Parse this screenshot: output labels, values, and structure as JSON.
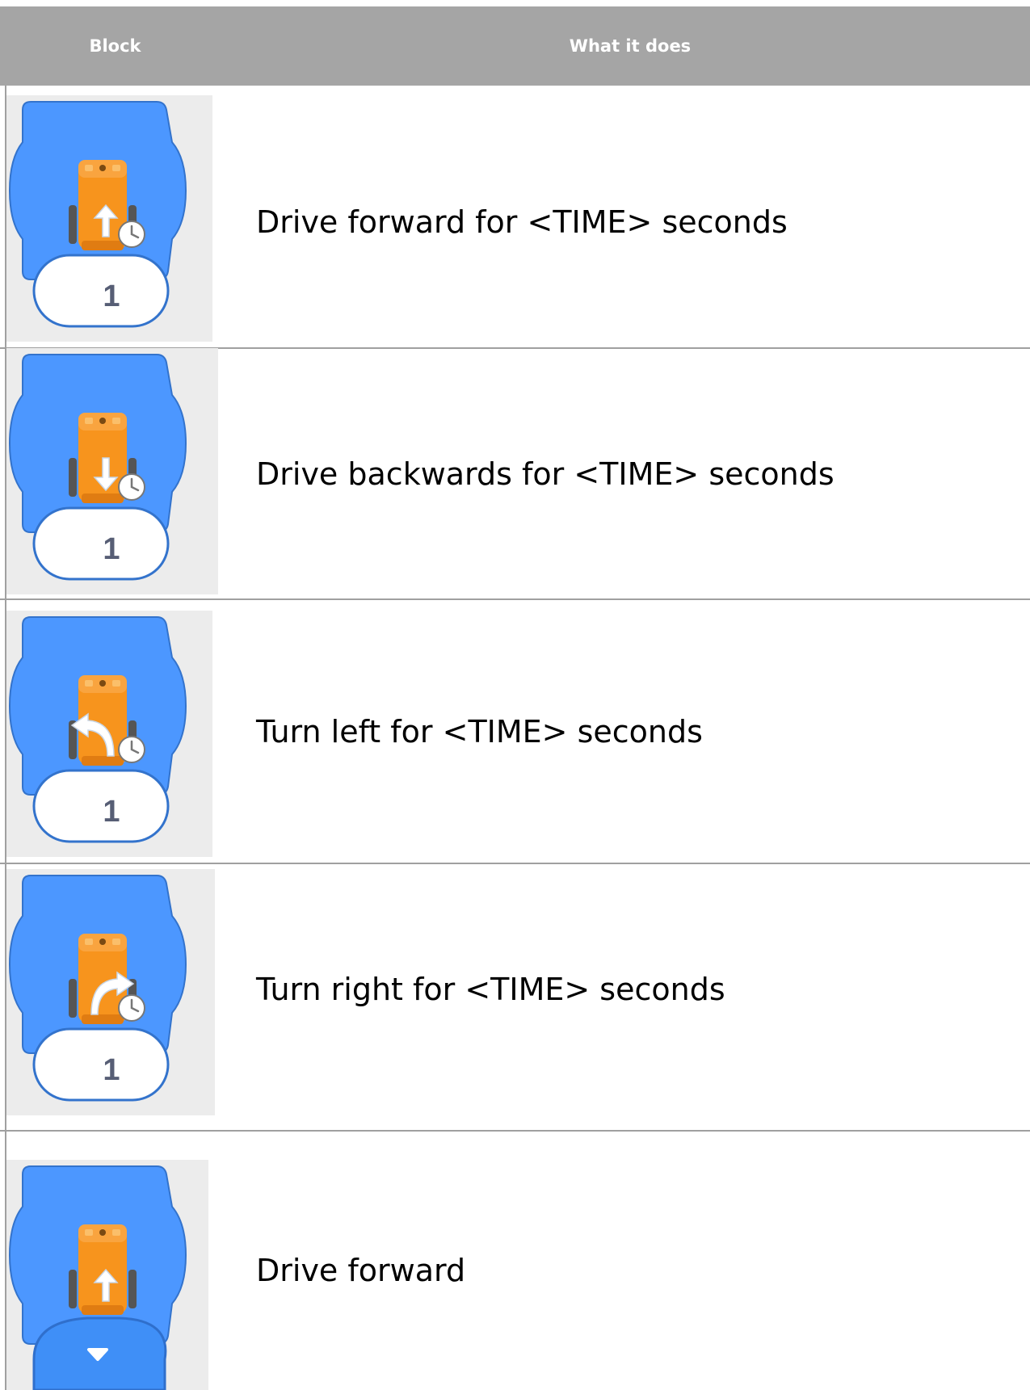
{
  "table": {
    "headers": {
      "block": "Block",
      "what_it_does": "What it does"
    },
    "rows": [
      {
        "description": "Drive forward for <TIME> seconds",
        "value": "1",
        "icon": "robot-forward-arrow-icon",
        "timer": true
      },
      {
        "description": "Drive backwards for <TIME> seconds",
        "value": "1",
        "icon": "robot-backward-arrow-icon",
        "timer": true
      },
      {
        "description": "Turn left for <TIME> seconds",
        "value": "1",
        "icon": "robot-turn-left-arrow-icon",
        "timer": true
      },
      {
        "description": "Turn right for <TIME> seconds",
        "value": "1",
        "icon": "robot-turn-right-arrow-icon",
        "timer": true
      },
      {
        "description": "Drive forward",
        "value": "",
        "icon": "robot-forward-arrow-icon",
        "timer": false,
        "dropdown": "chevron-down-icon"
      }
    ]
  },
  "colors": {
    "header_bg": "#a5a5a5",
    "block_blue": "#4c97ff",
    "block_outline": "#3373cc",
    "robot_orange": "#f7941d",
    "tile_bg": "#ececec"
  }
}
